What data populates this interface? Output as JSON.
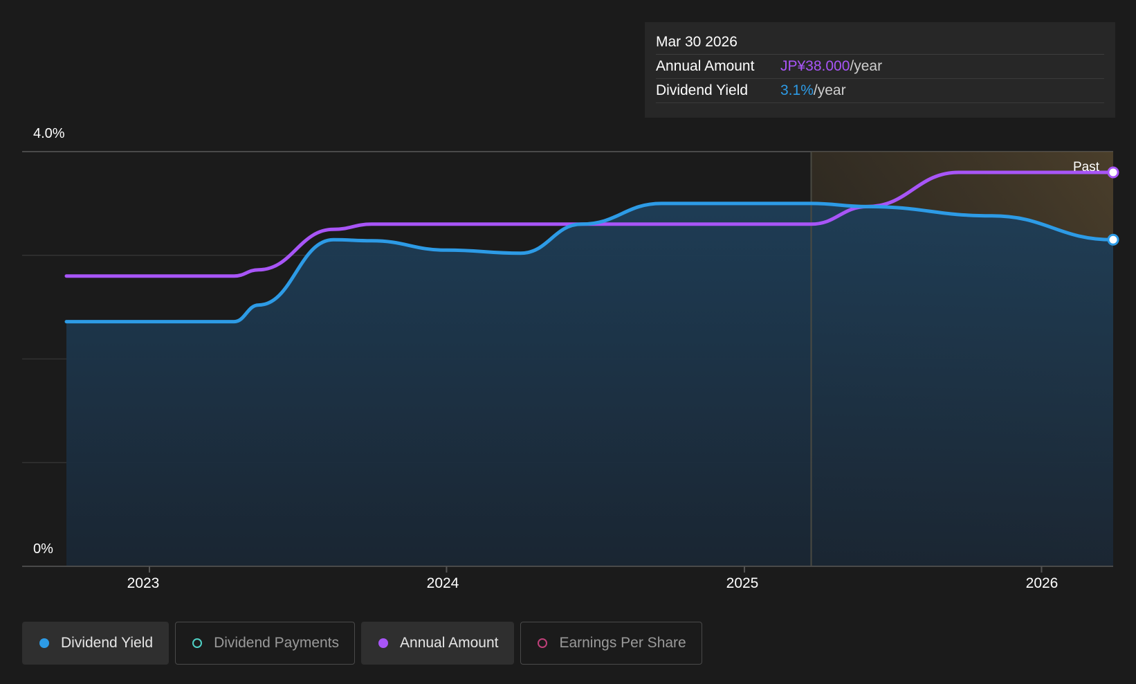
{
  "tooltip": {
    "date": "Mar 30 2026",
    "rows": [
      {
        "label": "Annual Amount",
        "value": "JP¥38.000",
        "unit": "/year",
        "color": "#a855f7"
      },
      {
        "label": "Dividend Yield",
        "value": "3.1%",
        "unit": "/year",
        "color": "#2d9be6"
      }
    ]
  },
  "past_label": "Past",
  "legend": [
    {
      "label": "Dividend Yield",
      "color": "#2d9be6",
      "active": true,
      "dot": "filled"
    },
    {
      "label": "Dividend Payments",
      "color": "#4fd1c5",
      "active": false,
      "dot": "hollow"
    },
    {
      "label": "Annual Amount",
      "color": "#a855f7",
      "active": true,
      "dot": "filled"
    },
    {
      "label": "Earnings Per Share",
      "color": "#c0407a",
      "active": false,
      "dot": "hollow"
    }
  ],
  "colors": {
    "background": "#1b1b1b",
    "yield_line": "#2d9be6",
    "annual_line": "#a855f7",
    "past_region": "#4a3e2c"
  },
  "chart_data": {
    "type": "line",
    "ylabel": "",
    "xlabel": "",
    "x_ticks": [
      "2023",
      "2024",
      "2025",
      "2026"
    ],
    "y_ticks": [
      "0%",
      "4.0%"
    ],
    "ylim": [
      0,
      4.0
    ],
    "xlim": [
      "2022-09-21",
      "2026-03-30"
    ],
    "past_boundary": "2025-03-24",
    "series": [
      {
        "name": "Dividend Yield",
        "unit": "%",
        "fill": true,
        "points": [
          [
            "2022-09-21",
            2.36
          ],
          [
            "2023-04-15",
            2.36
          ],
          [
            "2023-05-15",
            2.52
          ],
          [
            "2023-08-15",
            3.15
          ],
          [
            "2023-10-01",
            3.14
          ],
          [
            "2024-01-01",
            3.05
          ],
          [
            "2024-04-01",
            3.02
          ],
          [
            "2024-06-15",
            3.3
          ],
          [
            "2024-09-21",
            3.5
          ],
          [
            "2025-03-24",
            3.5
          ],
          [
            "2025-06-01",
            3.47
          ],
          [
            "2025-11-01",
            3.38
          ],
          [
            "2026-03-30",
            3.15
          ]
        ]
      },
      {
        "name": "Annual Amount",
        "unit": "JP¥",
        "fill": false,
        "points": [
          [
            "2022-09-21",
            2.8
          ],
          [
            "2023-04-15",
            2.8
          ],
          [
            "2023-05-15",
            2.86
          ],
          [
            "2023-08-15",
            3.25
          ],
          [
            "2023-10-01",
            3.3
          ],
          [
            "2025-03-24",
            3.3
          ],
          [
            "2025-06-01",
            3.47
          ],
          [
            "2025-09-21",
            3.8
          ],
          [
            "2026-03-30",
            3.8
          ]
        ]
      }
    ]
  }
}
